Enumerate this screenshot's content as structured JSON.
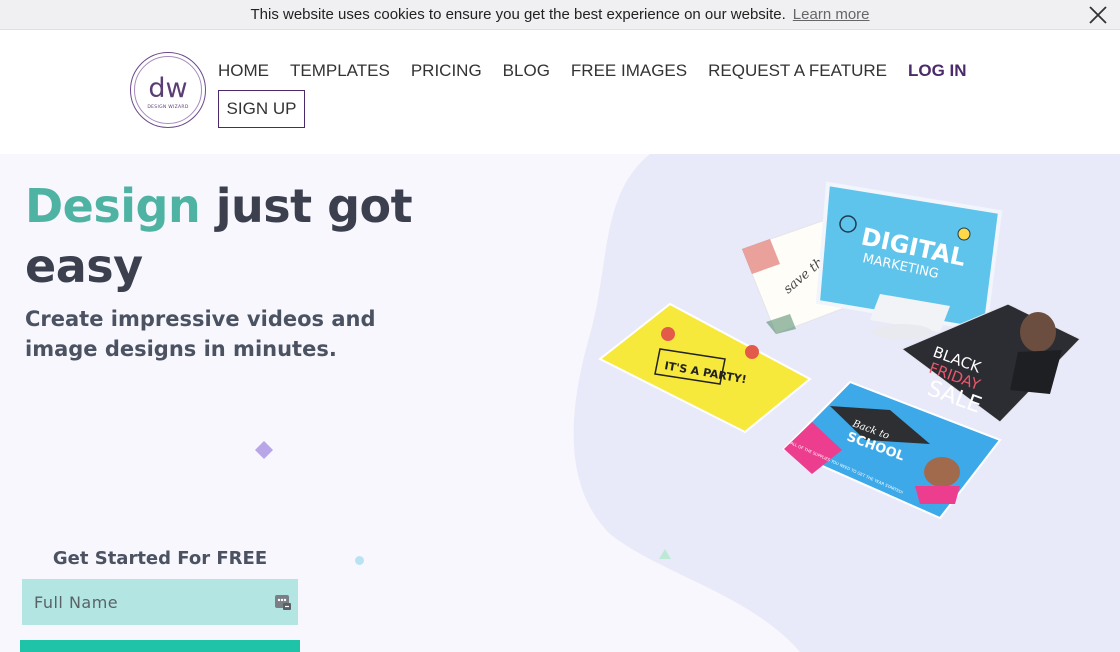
{
  "cookie": {
    "message": "This website uses cookies to ensure you get the best experience on our website.",
    "learn_more": "Learn more"
  },
  "logo": {
    "mark": "dw",
    "subtitle": "DESIGN WIZARD"
  },
  "nav": {
    "home": "HOME",
    "templates": "TEMPLATES",
    "pricing": "PRICING",
    "blog": "BLOG",
    "free_images": "FREE IMAGES",
    "request_feature": "REQUEST A FEATURE",
    "login": "LOG IN",
    "signup": "SIGN UP"
  },
  "hero": {
    "headline_accent": "Design",
    "headline_rest": " just got easy",
    "subhead": "Create impressive videos and image designs in minutes."
  },
  "form": {
    "title": "Get Started For FREE",
    "name_placeholder": "Full Name"
  },
  "cards": {
    "digital": "DIGITAL",
    "marketing": "MARKETING",
    "save_date": "save the date",
    "party": "IT'S A PARTY!",
    "black": "BLACK",
    "friday": "FRIDAY",
    "sale": "SALE",
    "back_to": "Back to",
    "school": "SCHOOL",
    "school_promo": "ALL OF THE SUPPLIES YOU NEED TO GET THE YEAR STARTED!"
  },
  "colors": {
    "accent_teal": "#4fb3a3",
    "brand_purple": "#4a2a6a",
    "cta_teal": "#1ec3a8",
    "input_bg": "#b3e6e2"
  },
  "icons": {
    "cookie_close": "close-icon",
    "input": "contact-card-icon"
  }
}
